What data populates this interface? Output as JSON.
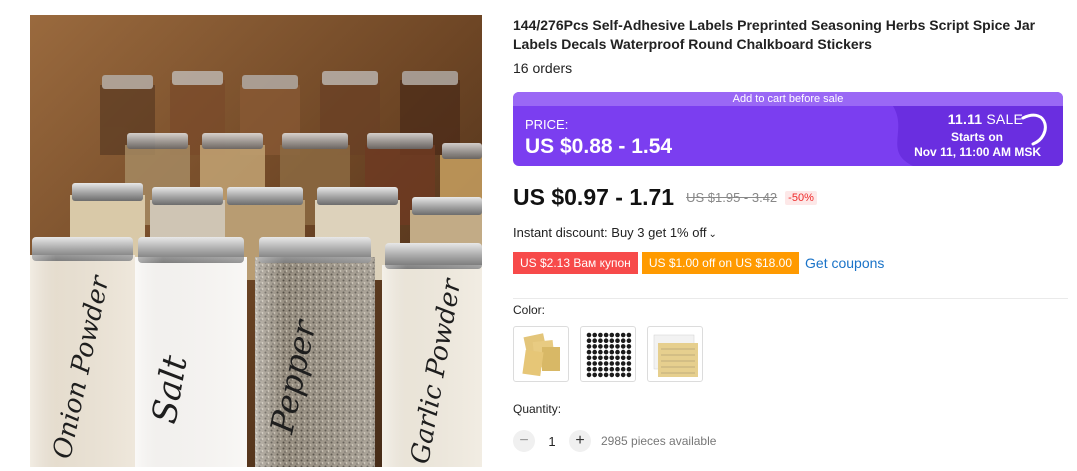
{
  "product": {
    "image_alt": "Spice jars with script labels",
    "jar_labels": [
      "Onion Powder",
      "Salt",
      "Pepper",
      "Garlic Powder"
    ],
    "title": "144/276Pcs Self-Adhesive Labels Preprinted Seasoning Herbs Script Spice Jar Labels Decals Waterproof Round Chalkboard Stickers",
    "orders": "16 orders"
  },
  "sale_banner": {
    "top_strip": "Add to cart before sale",
    "price_label": "PRICE:",
    "price_range": "US $0.88 - 1.54",
    "sale_prefix": "11.11",
    "sale_word": "SALE",
    "starts_on": "Starts on",
    "sale_date": "Nov 11, 11:00 AM MSK",
    "colors": {
      "banner": "#7b3ef0",
      "strip": "#9a68f5"
    }
  },
  "pricing": {
    "current": "US $0.97 - 1.71",
    "original": "US $1.95 - 3.42",
    "discount": "-50%"
  },
  "instant_discount": {
    "text": "Instant discount: Buy 3 get 1% off",
    "chevron_icon": "chevron-down-icon"
  },
  "coupons": {
    "red_coupon": "US $2.13 Вам купон",
    "orange_coupon": "US $1.00 off on US $18.00",
    "get_coupons": "Get coupons"
  },
  "options": {
    "color_label": "Color:",
    "swatch_names": [
      "kraft-labels-swatch",
      "black-round-labels-swatch",
      "clear-labels-swatch"
    ]
  },
  "quantity": {
    "label": "Quantity:",
    "value": "1",
    "minus": "−",
    "plus": "+",
    "available": "2985 pieces available"
  }
}
